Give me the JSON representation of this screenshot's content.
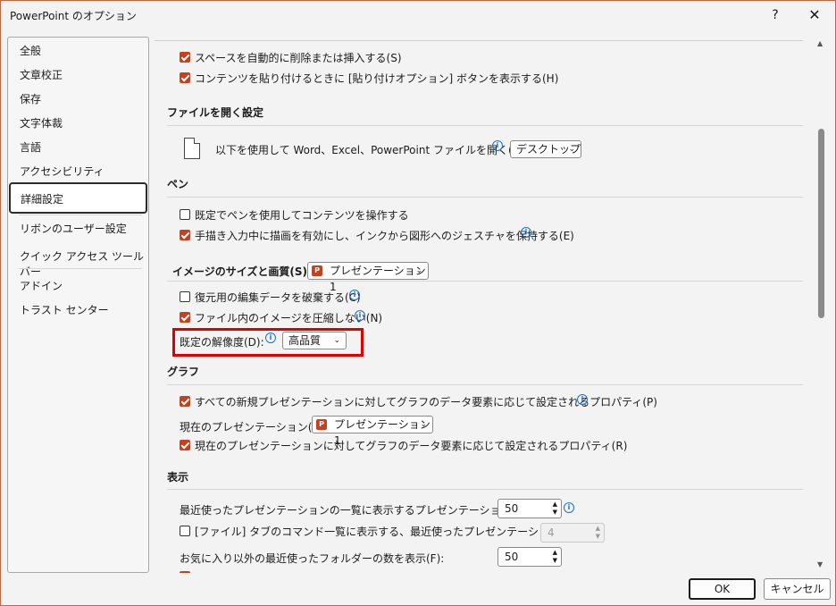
{
  "window": {
    "title": "PowerPoint のオプション",
    "help": "?",
    "close": "✕"
  },
  "sidebar": {
    "items": [
      "全般",
      "文章校正",
      "保存",
      "文字体裁",
      "言語",
      "アクセシビリティ",
      "詳細設定",
      "リボンのユーザー設定",
      "クイック アクセス ツール バー",
      "アドイン",
      "トラスト センター"
    ],
    "selected": "詳細設定"
  },
  "editing": {
    "smart_space": "スペースを自動的に削除または挿入する(S)",
    "paste_options": "コンテンツを貼り付けるときに [貼り付けオプション] ボタンを表示する(H)"
  },
  "file_open": {
    "heading": "ファイルを開く設定",
    "label": "以下を使用して Word、Excel、PowerPoint ファイルを開く(P):",
    "value": "デスクトップ"
  },
  "pen": {
    "heading": "ペン",
    "default_pen": "既定でペンを使用してコンテンツを操作する",
    "ink_gesture": "手描き入力中に描画を有効にし、インクから図形へのジェスチャを保持する(E)"
  },
  "image": {
    "heading": "イメージのサイズと画質(S)",
    "file": "プレゼンテーション1",
    "discard_edit": "復元用の編集データを破棄する(C)",
    "no_compress": "ファイル内のイメージを圧縮しない(N)",
    "resolution_label": "既定の解像度(D):",
    "resolution_value": "高品質"
  },
  "chart": {
    "heading": "グラフ",
    "all_new": "すべての新規プレゼンテーションに対してグラフのデータ要素に応じて設定されるプロパティ(P)",
    "current_label": "現在のプレゼンテーション(C):",
    "current_value": "プレゼンテーション1",
    "current_props": "現在のプレゼンテーションに対してグラフのデータ要素に応じて設定されるプロパティ(R)"
  },
  "display": {
    "heading": "表示",
    "recent_label": "最近使ったプレゼンテーションの一覧に表示するプレゼンテーションの数(R):",
    "recent_value": "50",
    "file_tab_label": "[ファイル] タブのコマンド一覧に表示する、最近使ったプレゼンテーションの数(Q):",
    "file_tab_value": "4",
    "folders_label": "お気に入り以外の最近使ったフォルダーの数を表示(F):",
    "folders_value": "50"
  },
  "buttons": {
    "ok": "OK",
    "cancel": "キャンセル"
  },
  "colors": {
    "accent": "#c4421f",
    "highlight": "#e00000",
    "info": "#1a6fc7"
  }
}
